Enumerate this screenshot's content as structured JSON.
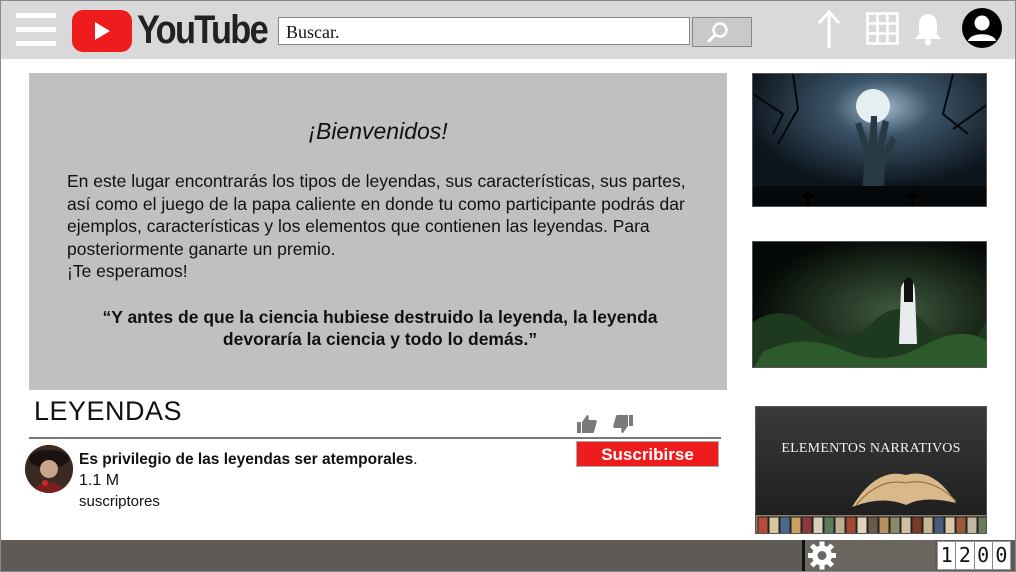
{
  "header": {
    "logo_text": "YouTube",
    "search_placeholder": "Buscar.",
    "icons": [
      "menu-icon",
      "search-icon",
      "upload-icon",
      "apps-grid-icon",
      "bell-icon",
      "account-icon"
    ]
  },
  "welcome": {
    "title": "¡Bienvenidos!",
    "body": "En este lugar encontrarás los tipos de leyendas, sus características, sus partes, así como el juego de la papa caliente en donde tu como participante podrás dar ejemplos, características y los elementos que contienen las leyendas. Para posteriormente ganarte un premio.",
    "closing": "¡Te esperamos!",
    "quote": "“Y antes de que la ciencia hubiese destruido la leyenda, la leyenda devoraría la ciencia y todo lo demás.”"
  },
  "channel": {
    "title": "LEYENDAS",
    "description": "Es privilegio de las leyendas ser atemporales",
    "description_end": ".",
    "subscriber_count": "1.1 M",
    "subscriber_label": "suscriptores",
    "subscribe_label": "Suscribirse"
  },
  "sidebar": {
    "thumbnail_3_title": "ELEMENTOS NARRATIVOS"
  },
  "footer": {
    "clock": [
      "1",
      "2",
      "0",
      "0"
    ]
  },
  "colors": {
    "brand_red": "#ee1c1c",
    "header_bg": "#d9d9d9",
    "panel_gray": "#c0c0c0",
    "footer_bg": "#5f5a55"
  }
}
